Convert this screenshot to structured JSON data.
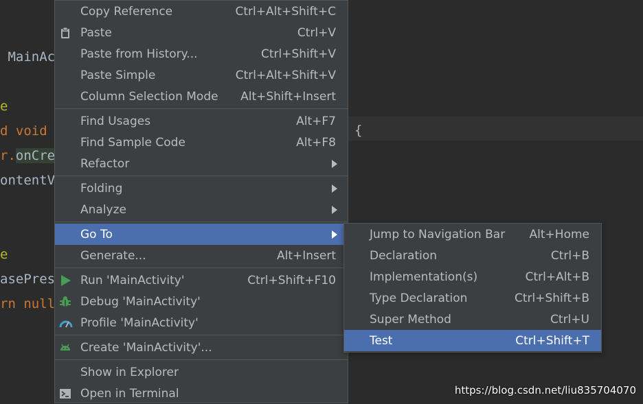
{
  "editor": {
    "lines": [
      {
        "text": " MainAc",
        "cls": ""
      },
      {
        "text": "e",
        "cls": "ann"
      },
      {
        "text": "d void ",
        "cls": "kw"
      },
      {
        "text": "r.onCre",
        "cls": "call"
      },
      {
        "text": "ontentV",
        "cls": ""
      },
      {
        "text": "e",
        "cls": "ann"
      },
      {
        "text": "asePres",
        "cls": ""
      },
      {
        "text": "rn null",
        "cls": "kw"
      }
    ],
    "brace": "{"
  },
  "context_menu": {
    "items": [
      {
        "type": "item",
        "label": "Copy Reference",
        "shortcut": "Ctrl+Alt+Shift+C",
        "icon": ""
      },
      {
        "type": "item",
        "label": "Paste",
        "shortcut": "Ctrl+V",
        "icon": "clipboard-icon"
      },
      {
        "type": "item",
        "label": "Paste from History...",
        "shortcut": "Ctrl+Shift+V",
        "icon": ""
      },
      {
        "type": "item",
        "label": "Paste Simple",
        "shortcut": "Ctrl+Alt+Shift+V",
        "icon": ""
      },
      {
        "type": "item",
        "label": "Column Selection Mode",
        "shortcut": "Alt+Shift+Insert",
        "icon": ""
      },
      {
        "type": "separator"
      },
      {
        "type": "item",
        "label": "Find Usages",
        "shortcut": "Alt+F7",
        "icon": ""
      },
      {
        "type": "item",
        "label": "Find Sample Code",
        "shortcut": "Alt+F8",
        "icon": ""
      },
      {
        "type": "item",
        "label": "Refactor",
        "shortcut": "",
        "submenu": true,
        "icon": ""
      },
      {
        "type": "separator"
      },
      {
        "type": "item",
        "label": "Folding",
        "shortcut": "",
        "submenu": true,
        "icon": ""
      },
      {
        "type": "item",
        "label": "Analyze",
        "shortcut": "",
        "submenu": true,
        "icon": ""
      },
      {
        "type": "separator"
      },
      {
        "type": "item",
        "label": "Go To",
        "shortcut": "",
        "submenu": true,
        "selected": true,
        "icon": ""
      },
      {
        "type": "item",
        "label": "Generate...",
        "shortcut": "Alt+Insert",
        "icon": ""
      },
      {
        "type": "separator"
      },
      {
        "type": "item",
        "label": "Run 'MainActivity'",
        "shortcut": "Ctrl+Shift+F10",
        "icon": "run-icon"
      },
      {
        "type": "item",
        "label": "Debug 'MainActivity'",
        "shortcut": "",
        "icon": "debug-icon"
      },
      {
        "type": "item",
        "label": "Profile 'MainActivity'",
        "shortcut": "",
        "icon": "profile-icon"
      },
      {
        "type": "separator"
      },
      {
        "type": "item",
        "label": "Create 'MainActivity'...",
        "shortcut": "",
        "icon": "android-icon"
      },
      {
        "type": "separator"
      },
      {
        "type": "item",
        "label": "Show in Explorer",
        "shortcut": "",
        "icon": ""
      },
      {
        "type": "item",
        "label": "Open in Terminal",
        "shortcut": "",
        "icon": "terminal-icon"
      }
    ]
  },
  "goto_submenu": {
    "items": [
      {
        "label": "Jump to Navigation Bar",
        "shortcut": "Alt+Home"
      },
      {
        "label": "Declaration",
        "shortcut": "Ctrl+B"
      },
      {
        "label": "Implementation(s)",
        "shortcut": "Ctrl+Alt+B"
      },
      {
        "label": "Type Declaration",
        "shortcut": "Ctrl+Shift+B"
      },
      {
        "label": "Super Method",
        "shortcut": "Ctrl+U"
      },
      {
        "label": "Test",
        "shortcut": "Ctrl+Shift+T",
        "selected": true
      }
    ]
  },
  "watermark": "https://blog.csdn.net/liu835704070",
  "colors": {
    "menu_bg": "#3c3f41",
    "selection": "#4b6eaf",
    "editor_bg": "#2b2b2b",
    "run_green": "#499c54",
    "profile_blue": "#40a0d0"
  }
}
